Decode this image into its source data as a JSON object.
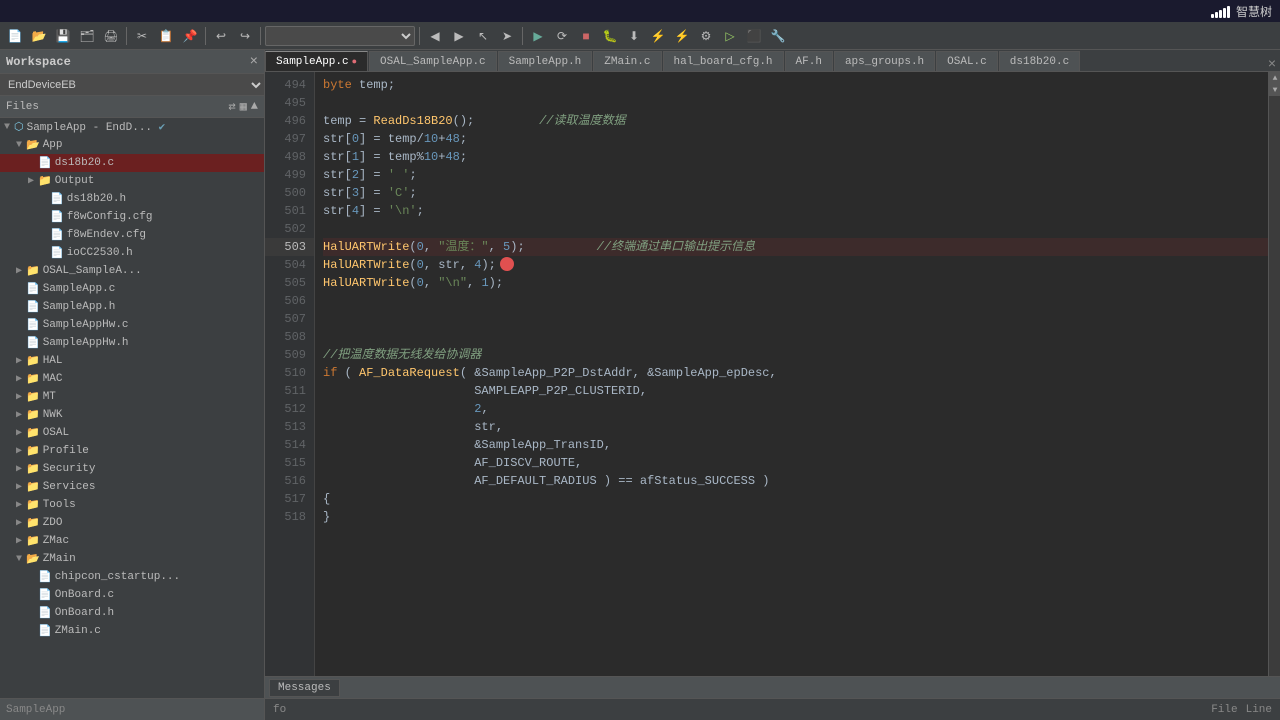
{
  "titlebar": {
    "app_name": "智慧树",
    "signal_label": "signal"
  },
  "toolbar": {
    "dropdown_value": "",
    "dropdown_placeholder": ""
  },
  "sidebar": {
    "title": "Workspace",
    "close_label": "×",
    "device": "EndDeviceEB",
    "files_label": "Files",
    "bottom_label": "SampleApp",
    "tree": [
      {
        "id": "sampleapp-root",
        "label": "SampleApp - EndD...",
        "indent": 0,
        "type": "project",
        "expanded": true,
        "checkmark": true
      },
      {
        "id": "app-folder",
        "label": "App",
        "indent": 1,
        "type": "folder",
        "expanded": true
      },
      {
        "id": "ds18b20-file",
        "label": "ds18b20.c",
        "indent": 2,
        "type": "file-c",
        "selected": true,
        "highlighted": true
      },
      {
        "id": "output-folder",
        "label": "Output",
        "indent": 2,
        "type": "folder",
        "expanded": false
      },
      {
        "id": "ds18b20h-file",
        "label": "ds18b20.h",
        "indent": 3,
        "type": "file-h"
      },
      {
        "id": "f8wconfig-file",
        "label": "f8wConfig.cfg",
        "indent": 3,
        "type": "file-cfg"
      },
      {
        "id": "f8wendev-file",
        "label": "f8wEndev.cfg",
        "indent": 3,
        "type": "file-cfg"
      },
      {
        "id": "iocc2530h-file",
        "label": "ioCC2530.h",
        "indent": 3,
        "type": "file-h"
      },
      {
        "id": "osal-folder",
        "label": "OSAL_SampleA...",
        "indent": 1,
        "type": "folder",
        "expanded": false
      },
      {
        "id": "sampleappc-file",
        "label": "SampleApp.c",
        "indent": 1,
        "type": "file-c"
      },
      {
        "id": "sampleapph-file",
        "label": "SampleApp.h",
        "indent": 1,
        "type": "file-h"
      },
      {
        "id": "sampleapphwc-file",
        "label": "SampleAppHw.c",
        "indent": 1,
        "type": "file-c"
      },
      {
        "id": "sampleapphwh-file",
        "label": "SampleAppHw.h",
        "indent": 1,
        "type": "file-h"
      },
      {
        "id": "hal-folder",
        "label": "HAL",
        "indent": 1,
        "type": "folder"
      },
      {
        "id": "mac-folder",
        "label": "MAC",
        "indent": 1,
        "type": "folder"
      },
      {
        "id": "mt-folder",
        "label": "MT",
        "indent": 1,
        "type": "folder"
      },
      {
        "id": "nwk-folder",
        "label": "NWK",
        "indent": 1,
        "type": "folder"
      },
      {
        "id": "osal2-folder",
        "label": "OSAL",
        "indent": 1,
        "type": "folder"
      },
      {
        "id": "profile-folder",
        "label": "Profile",
        "indent": 1,
        "type": "folder"
      },
      {
        "id": "security-folder",
        "label": "Security",
        "indent": 1,
        "type": "folder"
      },
      {
        "id": "services-folder",
        "label": "Services",
        "indent": 1,
        "type": "folder"
      },
      {
        "id": "tools-folder",
        "label": "Tools",
        "indent": 1,
        "type": "folder"
      },
      {
        "id": "zdo-folder",
        "label": "ZDO",
        "indent": 1,
        "type": "folder"
      },
      {
        "id": "zmac-folder",
        "label": "ZMac",
        "indent": 1,
        "type": "folder"
      },
      {
        "id": "zmain-folder",
        "label": "ZMain",
        "indent": 1,
        "type": "folder",
        "expanded": true
      },
      {
        "id": "chipcon-file",
        "label": "chipcon_cstartup...",
        "indent": 2,
        "type": "file-c"
      },
      {
        "id": "onboardc-file",
        "label": "OnBoard.c",
        "indent": 2,
        "type": "file-c"
      },
      {
        "id": "onboardh-file",
        "label": "OnBoard.h",
        "indent": 2,
        "type": "file-h"
      },
      {
        "id": "zmainc-file",
        "label": "ZMain.c",
        "indent": 2,
        "type": "file-c"
      }
    ]
  },
  "tabs": [
    {
      "label": "SampleApp.c",
      "active": true,
      "modified": true
    },
    {
      "label": "OSAL_SampleApp.c",
      "active": false
    },
    {
      "label": "SampleApp.h",
      "active": false
    },
    {
      "label": "ZMain.c",
      "active": false
    },
    {
      "label": "hal_board_cfg.h",
      "active": false
    },
    {
      "label": "AF.h",
      "active": false
    },
    {
      "label": "aps_groups.h",
      "active": false
    },
    {
      "label": "OSAL.c",
      "active": false
    },
    {
      "label": "ds18b20.c",
      "active": false
    }
  ],
  "code": {
    "lines": [
      {
        "num": 494,
        "content": "byte temp;"
      },
      {
        "num": 495,
        "content": ""
      },
      {
        "num": 496,
        "content": "temp = ReadDs18B20();",
        "comment": "//读取温度数据"
      },
      {
        "num": 497,
        "content": "str[0] = temp/10+48;"
      },
      {
        "num": 498,
        "content": "str[1] = temp%10+48;"
      },
      {
        "num": 499,
        "content": "str[2] = ' ';"
      },
      {
        "num": 500,
        "content": "str[3] = 'C';"
      },
      {
        "num": 501,
        "content": "str[4] = '\\n';"
      },
      {
        "num": 502,
        "content": ""
      },
      {
        "num": 503,
        "content": "HalUARTWrite(0, \"温度：\", 5);",
        "comment": "//终端通过串口输出提示信息",
        "highlighted": true
      },
      {
        "num": 504,
        "content": "HalUARTWrite(0, str, 4);",
        "dot": true
      },
      {
        "num": 505,
        "content": "HalUARTWrite(0, \"\\n\", 1);"
      },
      {
        "num": 506,
        "content": ""
      },
      {
        "num": 507,
        "content": ""
      },
      {
        "num": 508,
        "content": ""
      },
      {
        "num": 509,
        "content": "//把温度数据无线发给协调器"
      },
      {
        "num": 510,
        "content": "if ( AF_DataRequest( &SampleApp_P2P_DstAddr, &SampleApp_epDesc,"
      },
      {
        "num": 511,
        "content": "                     SAMPLEAPP_P2P_CLUSTERID,"
      },
      {
        "num": 512,
        "content": "                     2,"
      },
      {
        "num": 513,
        "content": "                     str,"
      },
      {
        "num": 514,
        "content": "                     &SampleApp_TransID,"
      },
      {
        "num": 515,
        "content": "                     AF_DISCV_ROUTE,"
      },
      {
        "num": 516,
        "content": "                     AF_DEFAULT_RADIUS ) == afStatus_SUCCESS )"
      },
      {
        "num": 517,
        "content": "{"
      },
      {
        "num": 518,
        "content": "}"
      }
    ]
  },
  "statusbar": {
    "left": "fo",
    "file_label": "File",
    "line_label": "Line",
    "bottom_panel_label": "Messages"
  }
}
